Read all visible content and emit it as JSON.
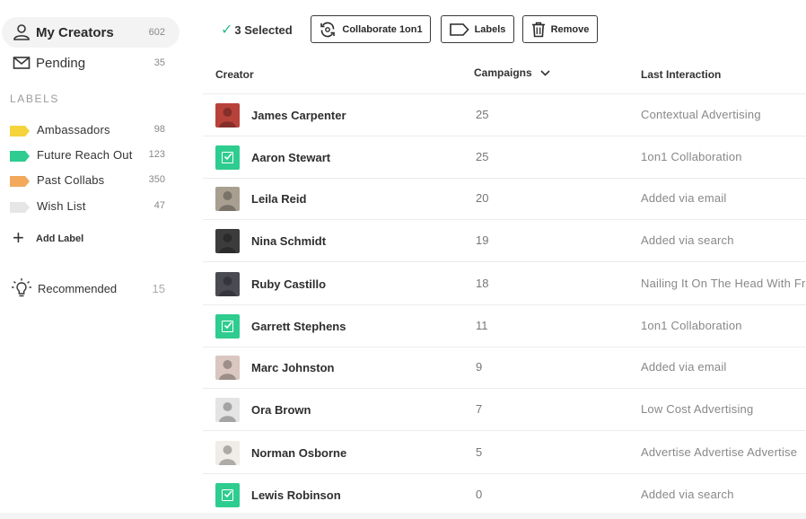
{
  "sidebar": {
    "nav": [
      {
        "label": "My Creators",
        "count": "602",
        "active": true
      },
      {
        "label": "Pending",
        "count": "35",
        "active": false
      }
    ],
    "labels_heading": "LABELS",
    "labels": [
      {
        "label": "Ambassadors",
        "count": "98",
        "color": "#f4d43a"
      },
      {
        "label": "Future Reach Out",
        "count": "123",
        "color": "#2ecc8f"
      },
      {
        "label": "Past Collabs",
        "count": "350",
        "color": "#f2a95c"
      },
      {
        "label": "Wish List",
        "count": "47",
        "color": "#e6e6e6"
      }
    ],
    "add_label": "Add Label",
    "recommended": {
      "label": "Recommended",
      "count": "15"
    }
  },
  "toolbar": {
    "selected_text": "3 Selected",
    "collaborate_label": "Collaborate 1on1",
    "labels_label": "Labels",
    "remove_label": "Remove"
  },
  "table": {
    "headers": {
      "creator": "Creator",
      "campaigns": "Campaigns",
      "last_interaction": "Last Interaction"
    },
    "rows": [
      {
        "name": "James Carpenter",
        "campaigns": "25",
        "last": "Contextual Advertising",
        "selected": false,
        "avatar": "#b8423a"
      },
      {
        "name": "Aaron Stewart",
        "campaigns": "25",
        "last": "1on1 Collaboration",
        "selected": true,
        "avatar": ""
      },
      {
        "name": "Leila Reid",
        "campaigns": "20",
        "last": "Added via email",
        "selected": false,
        "avatar": "#a89f90"
      },
      {
        "name": "Nina Schmidt",
        "campaigns": "19",
        "last": "Added via search",
        "selected": false,
        "avatar": "#3c3c3c"
      },
      {
        "name": "Ruby Castillo",
        "campaigns": "18",
        "last": "Nailing It On The Head With Free",
        "selected": false,
        "avatar": "#4a4a52"
      },
      {
        "name": "Garrett Stephens",
        "campaigns": "11",
        "last": "1on1 Collaboration",
        "selected": true,
        "avatar": ""
      },
      {
        "name": "Marc Johnston",
        "campaigns": "9",
        "last": "Added via email",
        "selected": false,
        "avatar": "#d9c7c0"
      },
      {
        "name": "Ora Brown",
        "campaigns": "7",
        "last": "Low Cost Advertising",
        "selected": false,
        "avatar": "#e4e4e4"
      },
      {
        "name": "Norman Osborne",
        "campaigns": "5",
        "last": "Advertise Advertise Advertise",
        "selected": false,
        "avatar": "#f0ede8"
      },
      {
        "name": "Lewis Robinson",
        "campaigns": "0",
        "last": "Added via search",
        "selected": true,
        "avatar": ""
      }
    ]
  }
}
